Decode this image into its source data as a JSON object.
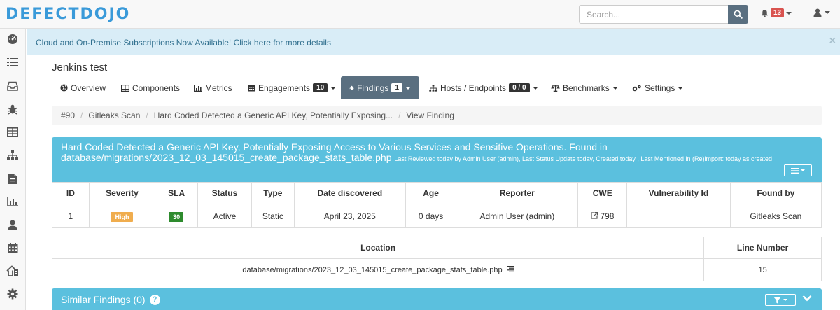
{
  "app": {
    "logo_text": "DEFECTDOJO"
  },
  "search": {
    "placeholder": "Search...",
    "value": ""
  },
  "notifications": {
    "count": "13"
  },
  "alert": {
    "text": "Cloud and On-Premise Subscriptions Now Available! Click here for more details",
    "close": "×"
  },
  "product": {
    "title": "Jenkins test"
  },
  "tabs": [
    {
      "label": "Overview",
      "icon": "globe-icon"
    },
    {
      "label": "Components",
      "icon": "table-icon"
    },
    {
      "label": "Metrics",
      "icon": "bar-chart-icon"
    },
    {
      "label": "Engagements",
      "icon": "calendar-icon",
      "count": "10"
    },
    {
      "label": "Findings",
      "icon": "bug-icon",
      "count": "1"
    },
    {
      "label": "Hosts / Endpoints",
      "icon": "sitemap-icon",
      "count": "0 / 0"
    },
    {
      "label": "Benchmarks",
      "icon": "balance-scale-icon"
    },
    {
      "label": "Settings",
      "icon": "cogs-icon"
    }
  ],
  "breadcrumb": [
    "#90",
    "Gitleaks Scan",
    "Hard Coded Detected a Generic API Key, Potentially Exposing...",
    "View Finding"
  ],
  "finding": {
    "title": "Hard Coded Detected a Generic API Key, Potentially Exposing Access to Various Services and Sensitive Operations. Found in database/migrations/2023_12_03_145015_create_package_stats_table.php",
    "meta": "Last Reviewed today by Admin User (admin), Last Status Update today, Created today , Last Mentioned in (Re)import: today as created",
    "columns": [
      "ID",
      "Severity",
      "SLA",
      "Status",
      "Type",
      "Date discovered",
      "Age",
      "Reporter",
      "CWE",
      "Vulnerability Id",
      "Found by"
    ],
    "row": {
      "id": "1",
      "severity": "High",
      "sla": "30",
      "status": "Active",
      "type": "Static",
      "date": "April 23, 2025",
      "age": "0 days",
      "reporter": "Admin User (admin)",
      "cwe": "798",
      "vuln_id": "",
      "found_by": "Gitleaks Scan"
    }
  },
  "location": {
    "columns": [
      "Location",
      "Line Number"
    ],
    "path": "database/migrations/2023_12_03_145015_create_package_stats_table.php",
    "line": "15"
  },
  "similar": {
    "title": "Similar Findings (0)",
    "help": "?"
  },
  "colors": {
    "brand": "#3a9ad9",
    "panel": "#5bc0de",
    "active_tab": "#5a6f80",
    "severity_high": "#f0ad4e",
    "sla_ok": "#2e8b2e"
  }
}
